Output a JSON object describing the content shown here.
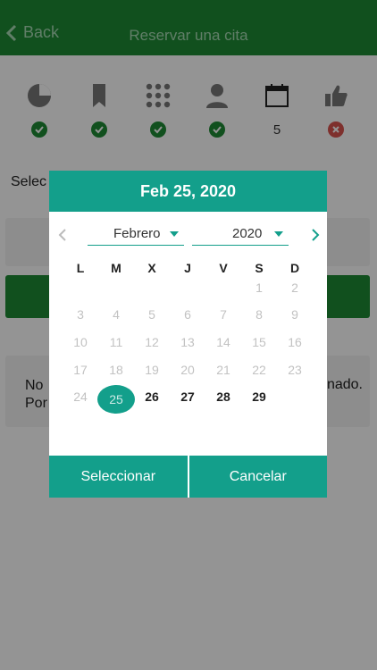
{
  "header": {
    "back_label": "Back",
    "title": "Reservar una cita"
  },
  "steps": [
    {
      "icon": "pie-chart-icon",
      "status": "done"
    },
    {
      "icon": "bookmark-icon",
      "status": "done"
    },
    {
      "icon": "grid-icon",
      "status": "done"
    },
    {
      "icon": "person-icon",
      "status": "done"
    },
    {
      "icon": "calendar-icon",
      "status": "number",
      "number": "5"
    },
    {
      "icon": "thumbs-up-icon",
      "status": "error"
    }
  ],
  "page": {
    "select_label": "Selec",
    "info_left_line1": "No",
    "info_left_line2": "Por",
    "info_right": "nado."
  },
  "datepicker": {
    "title": "Feb 25, 2020",
    "month": "Febrero",
    "year": "2020",
    "weekdays": [
      "L",
      "M",
      "X",
      "J",
      "V",
      "S",
      "D"
    ],
    "rows": [
      [
        "",
        "",
        "",
        "",
        "",
        "1",
        "2"
      ],
      [
        "3",
        "4",
        "5",
        "6",
        "7",
        "8",
        "9"
      ],
      [
        "10",
        "11",
        "12",
        "13",
        "14",
        "15",
        "16"
      ],
      [
        "17",
        "18",
        "19",
        "20",
        "21",
        "22",
        "23"
      ],
      [
        "24",
        "25",
        "26",
        "27",
        "28",
        "29",
        ""
      ]
    ],
    "selected_day": "25",
    "select_button": "Seleccionar",
    "cancel_button": "Cancelar"
  },
  "colors": {
    "brand_green": "#1e8a35",
    "teal": "#139f8b",
    "error_red": "#d9534f"
  }
}
